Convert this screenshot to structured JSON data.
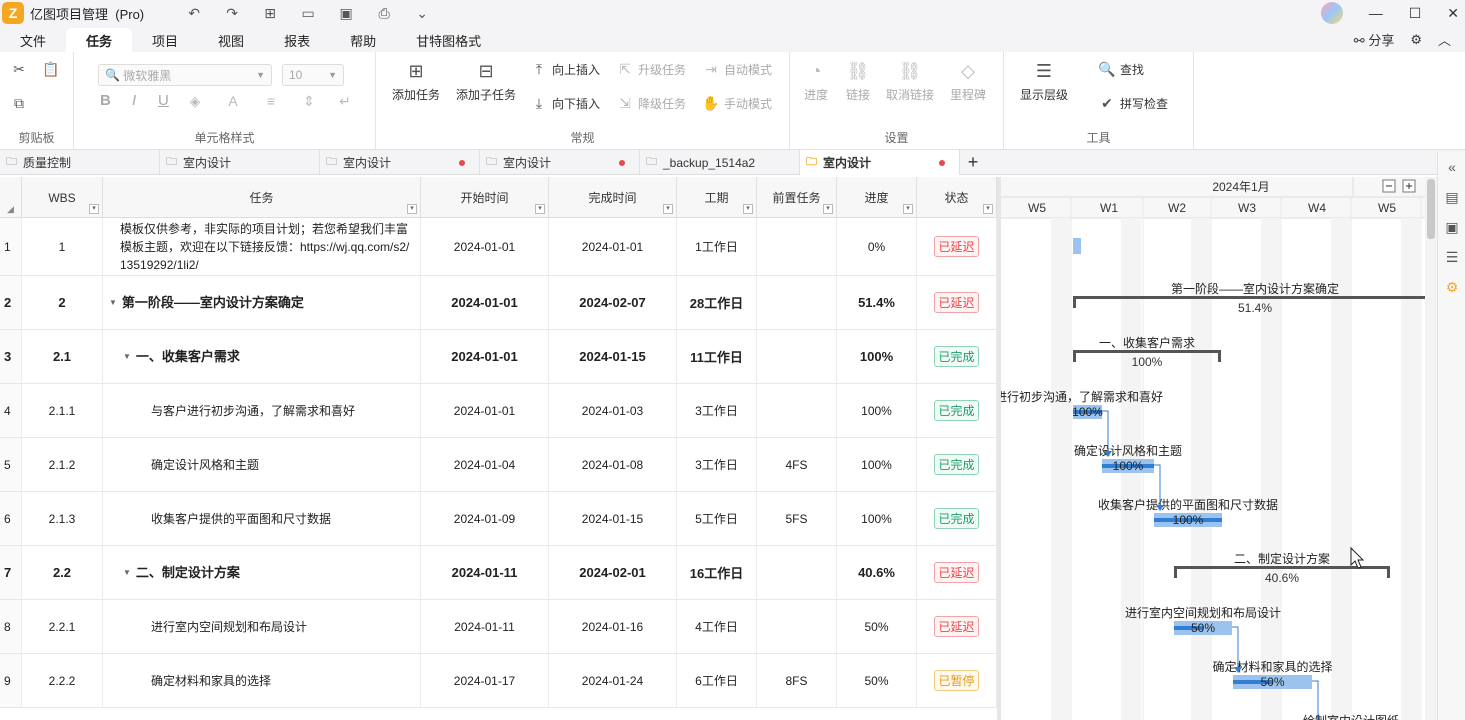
{
  "app": {
    "title": "亿图项目管理",
    "edition": "(Pro)"
  },
  "menus": [
    {
      "label": "文件",
      "active": false
    },
    {
      "label": "任务",
      "active": true
    },
    {
      "label": "项目",
      "active": false
    },
    {
      "label": "视图",
      "active": false
    },
    {
      "label": "报表",
      "active": false
    },
    {
      "label": "帮助",
      "active": false
    },
    {
      "label": "甘特图格式",
      "active": false
    }
  ],
  "share_label": "分享",
  "ribbon": {
    "font_name": "微软雅黑",
    "font_size": "10",
    "groups": {
      "clipboard": "剪贴板",
      "cell_style": "单元格样式",
      "general": "常规",
      "settings": "设置",
      "tools": "工具"
    },
    "buttons": {
      "add_task": "添加任务",
      "add_subtask": "添加子任务",
      "insert_up": "向上插入",
      "insert_down": "向下插入",
      "upgrade": "升级任务",
      "downgrade": "降级任务",
      "auto_mode": "自动模式",
      "manual_mode": "手动模式",
      "progress": "进度",
      "link": "链接",
      "unlink": "取消链接",
      "milestone": "里程碑",
      "show_level": "显示层级",
      "find": "查找",
      "spell_check": "拼写检查"
    }
  },
  "doc_tabs": [
    {
      "label": "质量控制",
      "active": false,
      "modified": false
    },
    {
      "label": "室内设计",
      "active": false,
      "modified": false
    },
    {
      "label": "室内设计",
      "active": false,
      "modified": true
    },
    {
      "label": "室内设计",
      "active": false,
      "modified": true
    },
    {
      "label": "_backup_1514a2",
      "active": false,
      "modified": false
    },
    {
      "label": "室内设计",
      "active": true,
      "modified": true
    }
  ],
  "columns": {
    "wbs": "WBS",
    "task": "任务",
    "start": "开始时间",
    "end": "完成时间",
    "duration": "工期",
    "predecessor": "前置任务",
    "progress": "进度",
    "status": "状态"
  },
  "rows": [
    {
      "num": "1",
      "wbs": "1",
      "task": "模板仅供参考，非实际的项目计划；若您希望我们丰富模板主题，欢迎在以下链接反馈：https://wj.qq.com/s2/13519292/1li2/",
      "start": "2024-01-01",
      "end": "2024-01-01",
      "duration": "1工作日",
      "pred": "",
      "progress": "0%",
      "status": "已延迟",
      "status_type": "red",
      "bold": false,
      "indent": 0,
      "toggle": false
    },
    {
      "num": "2",
      "wbs": "2",
      "task": "第一阶段——室内设计方案确定",
      "start": "2024-01-01",
      "end": "2024-02-07",
      "duration": "28工作日",
      "pred": "",
      "progress": "51.4%",
      "status": "已延迟",
      "status_type": "red",
      "bold": true,
      "indent": 0,
      "toggle": true
    },
    {
      "num": "3",
      "wbs": "2.1",
      "task": "一、收集客户需求",
      "start": "2024-01-01",
      "end": "2024-01-15",
      "duration": "11工作日",
      "pred": "",
      "progress": "100%",
      "status": "已完成",
      "status_type": "green",
      "bold": true,
      "indent": 1,
      "toggle": true
    },
    {
      "num": "4",
      "wbs": "2.1.1",
      "task": "与客户进行初步沟通，了解需求和喜好",
      "start": "2024-01-01",
      "end": "2024-01-03",
      "duration": "3工作日",
      "pred": "",
      "progress": "100%",
      "status": "已完成",
      "status_type": "green",
      "bold": false,
      "indent": 2,
      "toggle": false
    },
    {
      "num": "5",
      "wbs": "2.1.2",
      "task": "确定设计风格和主题",
      "start": "2024-01-04",
      "end": "2024-01-08",
      "duration": "3工作日",
      "pred": "4FS",
      "progress": "100%",
      "status": "已完成",
      "status_type": "green",
      "bold": false,
      "indent": 2,
      "toggle": false
    },
    {
      "num": "6",
      "wbs": "2.1.3",
      "task": "收集客户提供的平面图和尺寸数据",
      "start": "2024-01-09",
      "end": "2024-01-15",
      "duration": "5工作日",
      "pred": "5FS",
      "progress": "100%",
      "status": "已完成",
      "status_type": "green",
      "bold": false,
      "indent": 2,
      "toggle": false
    },
    {
      "num": "7",
      "wbs": "2.2",
      "task": "二、制定设计方案",
      "start": "2024-01-11",
      "end": "2024-02-01",
      "duration": "16工作日",
      "pred": "",
      "progress": "40.6%",
      "status": "已延迟",
      "status_type": "red",
      "bold": true,
      "indent": 1,
      "toggle": true
    },
    {
      "num": "8",
      "wbs": "2.2.1",
      "task": "进行室内空间规划和布局设计",
      "start": "2024-01-11",
      "end": "2024-01-16",
      "duration": "4工作日",
      "pred": "",
      "progress": "50%",
      "status": "已延迟",
      "status_type": "red",
      "bold": false,
      "indent": 2,
      "toggle": false
    },
    {
      "num": "9",
      "wbs": "2.2.2",
      "task": "确定材料和家具的选择",
      "start": "2024-01-17",
      "end": "2024-01-24",
      "duration": "6工作日",
      "pred": "8FS",
      "progress": "50%",
      "status": "已暂停",
      "status_type": "orange",
      "bold": false,
      "indent": 2,
      "toggle": false
    }
  ],
  "gantt": {
    "month_label": "2024年1月",
    "weeks": [
      "W5",
      "W1",
      "W2",
      "W3",
      "W4",
      "W5"
    ],
    "bars": [
      {
        "row": 0,
        "type": "task",
        "label": "",
        "progress_text": "",
        "progress": 0
      },
      {
        "row": 1,
        "type": "summary",
        "label": "第一阶段——室内设计方案确定",
        "progress_text": "51.4%",
        "progress": 0.514
      },
      {
        "row": 2,
        "type": "summary",
        "label": "一、收集客户需求",
        "progress_text": "100%",
        "progress": 1.0
      },
      {
        "row": 3,
        "type": "task",
        "label": "与客户进行初步沟通，了解需求和喜好",
        "progress_text": "100%",
        "progress": 1.0
      },
      {
        "row": 4,
        "type": "task",
        "label": "确定设计风格和主题",
        "progress_text": "100%",
        "progress": 1.0
      },
      {
        "row": 5,
        "type": "task",
        "label": "收集客户提供的平面图和尺寸数据",
        "progress_text": "100%",
        "progress": 1.0
      },
      {
        "row": 6,
        "type": "summary",
        "label": "二、制定设计方案",
        "progress_text": "40.6%",
        "progress": 0.406
      },
      {
        "row": 7,
        "type": "task",
        "label": "进行室内空间规划和布局设计",
        "progress_text": "50%",
        "progress": 0.5
      },
      {
        "row": 8,
        "type": "task",
        "label": "确定材料和家具的选择",
        "progress_text": "50%",
        "progress": 0.5
      },
      {
        "row": 9,
        "type": "task",
        "label": "绘制室内设计图纸",
        "progress_text": "",
        "progress": 0
      }
    ]
  },
  "colors": {
    "accent": "#f5a623",
    "bar_fill": "#9cc3ee",
    "bar_progress": "#2f7fd6",
    "summary": "#555555"
  }
}
